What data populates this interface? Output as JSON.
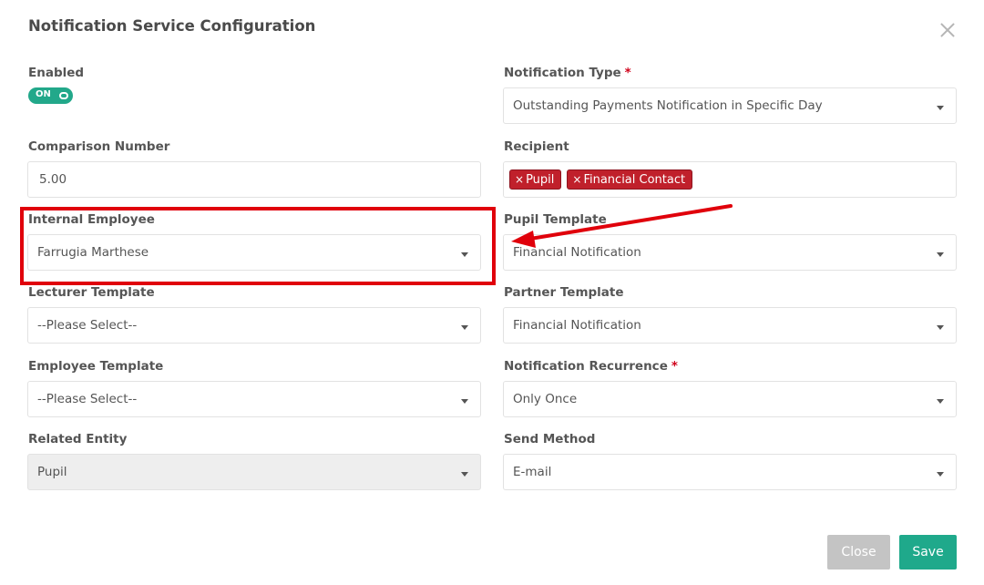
{
  "modal": {
    "title": "Notification Service Configuration"
  },
  "enabled": {
    "label": "Enabled",
    "toggle_text": "ON"
  },
  "notification_type": {
    "label": "Notification Type",
    "required": "*",
    "value": "Outstanding Payments Notification in Specific Day"
  },
  "comparison_number": {
    "label": "Comparison Number",
    "value": "5.00"
  },
  "recipient": {
    "label": "Recipient",
    "tags": [
      {
        "x": "×",
        "label": "Pupil"
      },
      {
        "x": "×",
        "label": "Financial Contact"
      }
    ]
  },
  "internal_employee": {
    "label": "Internal Employee",
    "value": "Farrugia Marthese"
  },
  "pupil_template": {
    "label": "Pupil Template",
    "value": "Financial Notification"
  },
  "lecturer_template": {
    "label": "Lecturer Template",
    "value": "--Please Select--"
  },
  "partner_template": {
    "label": "Partner Template",
    "value": "Financial Notification"
  },
  "employee_template": {
    "label": "Employee Template",
    "value": "--Please Select--"
  },
  "notification_recurrence": {
    "label": "Notification Recurrence",
    "required": "*",
    "value": "Only Once"
  },
  "related_entity": {
    "label": "Related Entity",
    "value": "Pupil"
  },
  "send_method": {
    "label": "Send Method",
    "value": "E-mail"
  },
  "footer": {
    "close_label": "Close",
    "save_label": "Save"
  },
  "colors": {
    "accent": "#1fa98b",
    "tag_red": "#c0202b",
    "annotation_red": "#e0000b"
  },
  "icons": {
    "close": "close-icon",
    "dropdown": "chevron-down-icon"
  }
}
